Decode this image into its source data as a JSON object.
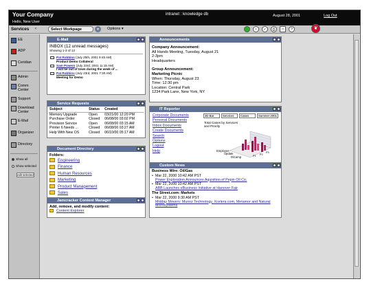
{
  "header": {
    "company": "Your Company",
    "title": "intranet : knowledge db",
    "welcome": "Hello, New User",
    "date": "August 28, 2001",
    "logout": "Log Out"
  },
  "toolbar": {
    "services_label": "Services",
    "select_workpage": "Select Workpage",
    "options": "Options",
    "icons": [
      "status-green-icon",
      "info-icon",
      "check-icon",
      "print-icon",
      "folder-icon",
      "help-icon",
      "logo-icon"
    ]
  },
  "sidebar": {
    "items": [
      {
        "label": "EE",
        "icon": "ee-icon"
      },
      {
        "label": "ADP",
        "icon": "adp-icon"
      },
      {
        "label": "Ceridian",
        "icon": "ceridian-icon"
      },
      {
        "label": "Admin",
        "icon": "admin-icon"
      },
      {
        "label": "Comm Center",
        "icon": "comm-center-icon"
      },
      {
        "label": "Support",
        "icon": "support-icon"
      },
      {
        "label": "Download Center",
        "icon": "download-icon"
      },
      {
        "label": "E-Mail",
        "icon": "email-icon"
      },
      {
        "label": "Organizer",
        "icon": "organizer-icon"
      },
      {
        "label": "Directory",
        "icon": "directory-icon"
      }
    ],
    "show_all": "Show all",
    "show_selected": "Show selected",
    "edit_selected": "edit selected"
  },
  "email": {
    "title": "E-Mail",
    "inbox": "INBOX",
    "unread": "(12 unread messages)",
    "showing": "Showing 1-3 of 12",
    "messages": [
      {
        "sender": "Pat Robbins",
        "date": "(July 25th, 2001 9:45 AM)",
        "subject": "Product Demo Collateral"
      },
      {
        "sender": "Sam Powers",
        "date": "(July 23rd, 2001 11:15 AM)",
        "subject": "I will be out of town during the week of ..."
      },
      {
        "sender": "Pat Robbins",
        "date": "(July 23rd, 2001 7:30 AM)",
        "subject": "Meeting for Demo"
      }
    ]
  },
  "service_requests": {
    "title": "Service Requests",
    "columns": [
      "Subject",
      "Status",
      "Created"
    ],
    "rows": [
      [
        "Memory Upgrade",
        "Open",
        "03/21/00 12:20 PM"
      ],
      [
        "Purchase Order",
        "Closed",
        "06/08/00 03:02 PM"
      ],
      [
        "Provision Service",
        "Open",
        "06/08/00 03:15 AM"
      ],
      [
        "Printer 6 Needs ...",
        "Closed",
        "06/08/00 03:27 AM"
      ],
      [
        "Help With New OS",
        "Closed",
        "06/10/00 05:17 AM"
      ]
    ]
  },
  "document_directory": {
    "title": "Document Directory",
    "folders_label": "Folders:",
    "folders": [
      "Engineering",
      "Finance",
      "Human Resources",
      "Marketing",
      "Product Management",
      "Sales"
    ]
  },
  "content_manager": {
    "title": "Jamcracker Content Manager",
    "text": "Add, remove, and modify content:",
    "link": "Content Explorer"
  },
  "announcements": {
    "title": "Announcements",
    "items": [
      {
        "heading": "Company Announcement:",
        "lines": [
          "All Hands Meeting, Tuesday, August 21",
          "2-3pm",
          "Headquarters"
        ]
      },
      {
        "heading": "Group Announcement:",
        "subheading": "Marketing Picnic",
        "lines": [
          "When: Thursday, August 23",
          "Time: 12:30 pm",
          "Location: Central Park",
          "1234 Park Lane, New York, NY"
        ]
      }
    ]
  },
  "it_reporter": {
    "title": "IT Reporter",
    "links": [
      "Corporate Documents",
      "Personal Documents",
      "Inbox Documents",
      "Create Documents",
      "Search",
      "Options",
      "Logout",
      "Help"
    ],
    "selects": [
      "3D Bar",
      "Services",
      "Cases",
      "Summer 2001"
    ],
    "chart_caption": "Total Cases by Services and Priority",
    "chart_labels": [
      "Employee",
      "Update",
      "DiCamp",
      "P1",
      "P2",
      "P3"
    ]
  },
  "custom_news": {
    "title": "Custom News",
    "sections": [
      {
        "heading": "Business Wire: Oil/Gas",
        "items": [
          {
            "date": "Mar 22, 2000 10:42 AM PST",
            "headline": "Power Exploration Announces Aquisition of Pepin Oil Co."
          },
          {
            "date": "Mar 22, 2000 10:42 AM PST",
            "headline": "ABB Launches eBusiness Initiative at Hanover Fair"
          }
        ]
      },
      {
        "heading": "The Street.com: Markets",
        "items": [
          {
            "date": "Mar 22, 2000 9:30 AM PST",
            "headline": "Midday Movers: Munoz Technology, Xcelera.com, Metamor and Natural Microsystems"
          }
        ]
      }
    ]
  }
}
